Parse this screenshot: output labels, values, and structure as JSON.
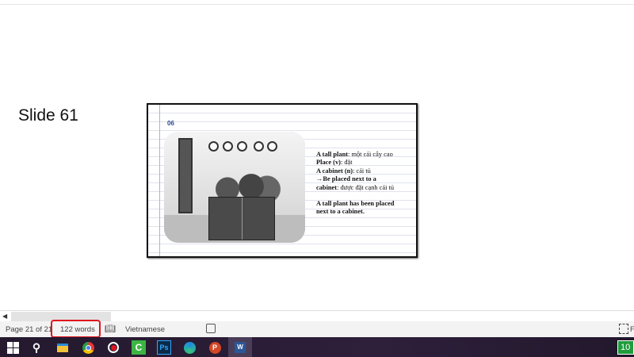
{
  "document": {
    "slide_label": "Slide 61",
    "slide": {
      "number": "06",
      "notes": [
        {
          "bold": "A tall plant",
          "rest": ": một cái cây cao"
        },
        {
          "bold": "Place (v)",
          "rest": ": đặt"
        },
        {
          "bold": "A cabinet (n)",
          "rest": ": cái tủ"
        },
        {
          "bold": "→Be placed next to a",
          "rest": ""
        },
        {
          "bold": "cabinet",
          "rest": ": được đặt cạnh cái tủ"
        },
        {
          "bold": "A tall plant has been placed",
          "rest": ""
        },
        {
          "bold": "next to a cabinet.",
          "rest": ""
        }
      ]
    }
  },
  "status_bar": {
    "page": "Page 21 of 21",
    "words": "122 words",
    "language": "Vietnamese",
    "focus_label": "F",
    "highlight_color": "#e0141e"
  },
  "taskbar": {
    "apps": [
      "windows-start-icon",
      "search-icon",
      "file-explorer-icon",
      "chrome-icon",
      "record-icon",
      "camtasia-icon",
      "photoshop-icon",
      "edge-icon",
      "powerpoint-icon",
      "word-icon"
    ],
    "badge": "10"
  }
}
